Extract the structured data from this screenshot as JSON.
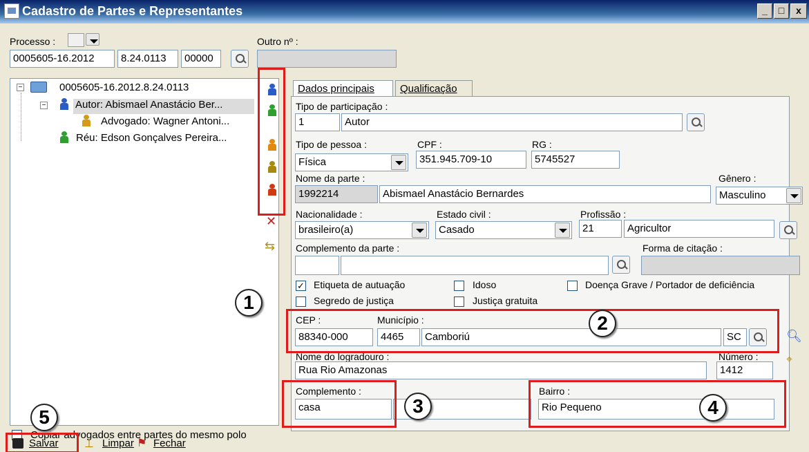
{
  "window": {
    "title": "Cadastro de Partes e Representantes",
    "buttons": [
      "_",
      "□",
      "x"
    ]
  },
  "processo": {
    "label": "Processo :",
    "num1": "0005605-16.2012",
    "num2": "8.24.0113",
    "num3": "00000",
    "outro_label": "Outro nº :",
    "outro_value": ""
  },
  "tree": {
    "root": "0005605-16.2012.8.24.0113",
    "autor": "Autor: Abismael Anastácio Ber...",
    "advogado": "Advogado: Wagner Antoni...",
    "reu": "Réu: Edson Gonçalves Pereira..."
  },
  "toolbar_icons": [
    "person-blue-icon",
    "person-green-icon",
    "person-orange-icon",
    "person-olive-icon",
    "person-red-icon",
    "remove-person-icon",
    "swap-persons-icon"
  ],
  "tabs": {
    "dados": "Dados principais",
    "qualificacao": "Qualificação"
  },
  "form": {
    "tipo_part_label": "Tipo de participação :",
    "tipo_part_code": "1",
    "tipo_part_value": "Autor",
    "tipo_pessoa_label": "Tipo de pessoa :",
    "tipo_pessoa_value": "Física",
    "cpf_label": "CPF :",
    "cpf_value": "351.945.709-10",
    "rg_label": "RG :",
    "rg_value": "5745527",
    "nome_label": "Nome da parte :",
    "nome_code": "1992214",
    "nome_value": "Abismael Anastácio Bernardes",
    "genero_label": "Gênero :",
    "genero_value": "Masculino",
    "nacionalidade_label": "Nacionalidade :",
    "nacionalidade_value": "brasileiro(a)",
    "estado_civil_label": "Estado civil :",
    "estado_civil_value": "Casado",
    "profissao_label": "Profissão :",
    "profissao_code": "21",
    "profissao_value": "Agricultor",
    "complemento_parte_label": "Complemento da parte :",
    "forma_citacao_label": "Forma de citação :",
    "chk_etiqueta": "Etiqueta de autuação",
    "chk_idoso": "Idoso",
    "chk_doenca": "Doença Grave / Portador de deficiência",
    "chk_segredo": "Segredo de justiça",
    "chk_justica": "Justiça gratuita",
    "cep_label": "CEP :",
    "cep_value": "88340-000",
    "municipio_label": "Município :",
    "municipio_code": "4465",
    "municipio_value": "Camboriú",
    "uf_value": "SC",
    "logradouro_label": "Nome do logradouro :",
    "logradouro_value": "Rua Rio Amazonas",
    "numero_label": "Número :",
    "numero_value": "1412",
    "complemento_label": "Complemento :",
    "complemento_value": "casa",
    "bairro_label": "Bairro :",
    "bairro_value": "Rio Pequeno"
  },
  "copiar_label": "Copiar advogados entre partes do mesmo polo",
  "bottom": {
    "salvar": "Salvar",
    "limpar": "Limpar",
    "fechar": "Fechar"
  },
  "callouts": [
    "1",
    "2",
    "3",
    "4",
    "5"
  ]
}
